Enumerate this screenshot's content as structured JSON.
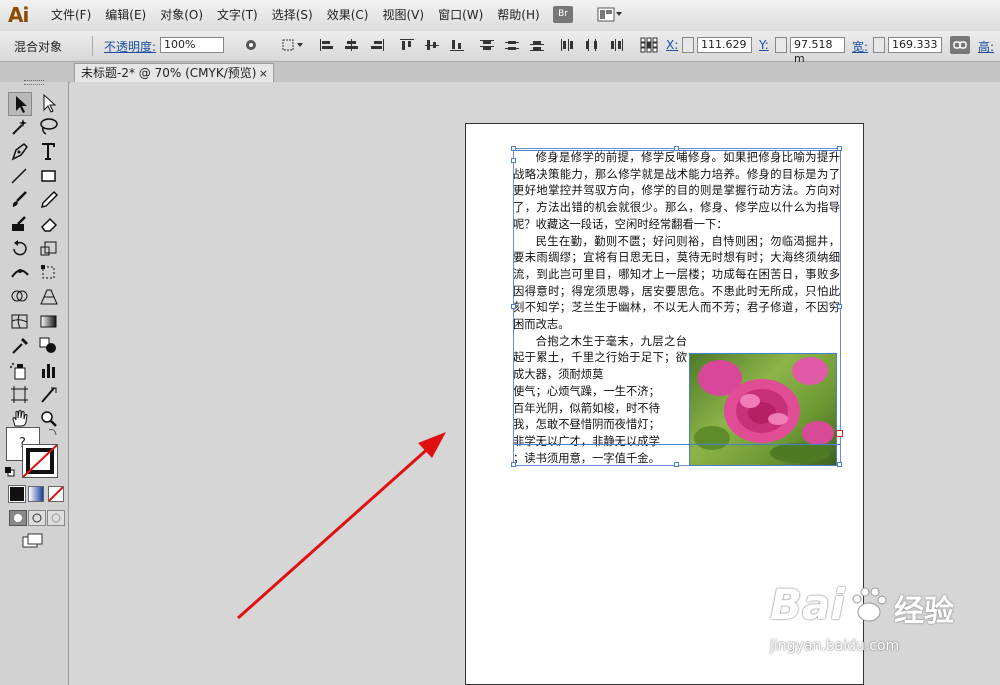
{
  "app": {
    "logo": "Ai"
  },
  "menu": [
    "文件(F)",
    "编辑(E)",
    "对象(O)",
    "文字(T)",
    "选择(S)",
    "效果(C)",
    "视图(V)",
    "窗口(W)",
    "帮助(H)"
  ],
  "bridge_label": "Br",
  "control": {
    "object_label": "混合对象",
    "opacity_label": "不透明度:",
    "opacity_value": "100%",
    "x_label": "X:",
    "x_value": "111.629",
    "y_label": "Y:",
    "y_value": "97.518 m",
    "w_label": "宽:",
    "w_value": "169.333",
    "h_label": "高:"
  },
  "document_tab": {
    "title": "未标题-2* @ 70% (CMYK/预览)",
    "close": "×"
  },
  "text_content": {
    "p1": "修身是修学的前提，修学反哺修身。如果把修身比喻为提升战略决策能力，那么修学就是战术能力培养。修身的目标是为了更好地掌控并驾驭方向，修学的目的则是掌握行动方法。方向对了，方法出错的机会就很少。那么，修身、修学应以什么为指导呢？收藏这一段话，空闲时经常翻看一下：",
    "p2": "民生在勤，勤则不匮；好问则裕，自恃则困；勿临渴掘井，要未雨绸缪；宜将有日思无日，莫待无时想有时；大海终须纳细流，到此岂可里目，哪知才上一层楼；功成每在困苦日，事败多因得意时；得宠须思辱，居安要思危。不患此时无所成，只怕此刻不知学；芝兰生于幽林，不以无人而不芳；君子修道，不因穷困而改志。",
    "p3_full": "合抱之木生于毫末，九层之台起于累土，千里之行始于足下；欲成大器，须耐烦莫",
    "p3_lines": [
      "使气；心烦气躁，一生不济；",
      "百年光阴，似箭如梭，时不待",
      "我，怎敢不昼惜阴而夜惜灯；",
      "非学无以广才，非静无以成学",
      "；读书须用意，一字值千金。"
    ]
  },
  "watermark": {
    "brand": "Bai",
    "brand2": "经验",
    "url": "jingyan.baidu.com"
  },
  "colors": {
    "arrow": "#e01010",
    "selection": "#4a7fd0"
  }
}
